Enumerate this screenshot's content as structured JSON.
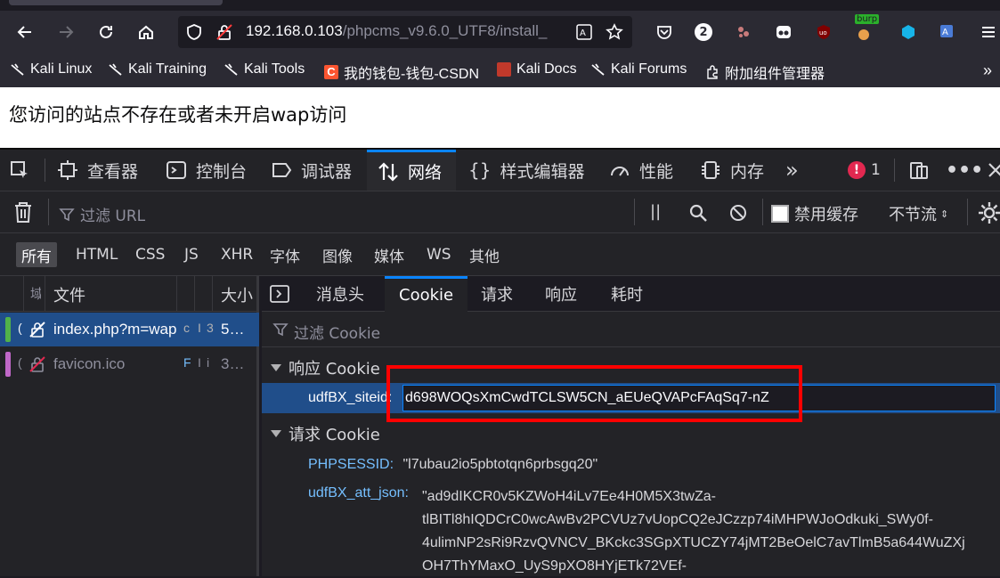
{
  "browser": {
    "url_host": "192.168.0.103",
    "url_path": "/phpcms_v9.6.0_UTF8/install_",
    "badge_count": "2",
    "burp_label": "burp"
  },
  "bookmarks": [
    {
      "label": "Kali Linux"
    },
    {
      "label": "Kali Training"
    },
    {
      "label": "Kali Tools"
    },
    {
      "label": "我的钱包-钱包-CSDN"
    },
    {
      "label": "Kali Docs"
    },
    {
      "label": "Kali Forums"
    },
    {
      "label": "附加组件管理器"
    }
  ],
  "page": {
    "message": "您访问的站点不存在或者未开启wap访问"
  },
  "devtools": {
    "tabs": {
      "inspector": "查看器",
      "console": "控制台",
      "debugger": "调试器",
      "network": "网络",
      "style_editor": "样式编辑器",
      "performance": "性能",
      "memory": "内存"
    },
    "error_count": "1",
    "filter_placeholder": "过滤 URL",
    "disable_cache": "禁用缓存",
    "throttle": "不节流",
    "types": [
      "所有",
      "HTML",
      "CSS",
      "JS",
      "XHR",
      "字体",
      "图像",
      "媒体",
      "WS",
      "其他"
    ],
    "columns": {
      "domain": "域",
      "file": "文件",
      "size": "大小"
    },
    "requests": [
      {
        "file": "index.php?m=wap",
        "size": "5…"
      },
      {
        "file": "favicon.ico",
        "size": "3…"
      }
    ],
    "detail_tabs": [
      "消息头",
      "Cookie",
      "请求",
      "响应",
      "耗时"
    ],
    "cookie_filter": "过滤 Cookie",
    "response_cookie_title": "响应 Cookie",
    "request_cookie_title": "请求 Cookie",
    "response_cookies": [
      {
        "name": "udfBX_siteid:",
        "value": "d698WOQsXmCwdTCLSW5CN_aEUeQVAPcFAqSq7-nZ"
      }
    ],
    "request_cookies": [
      {
        "name": "PHPSESSID:",
        "value": "\"l7ubau2io5pbtotqn6prbsgq20\""
      },
      {
        "name": "udfBX_att_json:",
        "value_lines": [
          "\"ad9dIKCR0v5KZWoH4iLv7Ee4H0M5X3twZa-",
          "tlBITl8hIQDCrC0wcAwBv2PCVUz7vUopCQ2eJCzzp74iMHPWJoOdkuki_SWy0f-",
          "4ulimNP2sRi9RzvQVNCV_BKckc3SGpXTUCZY74jMT2BeOelC7avTlmB5a644WuZXj",
          "OH7ThYMaxO_UyS9pXO8HYjETk72VEf-"
        ]
      }
    ]
  },
  "colors": {
    "highlight_box": "#ff0000",
    "accent": "#0a84ff",
    "selected_row": "#204e8a"
  }
}
